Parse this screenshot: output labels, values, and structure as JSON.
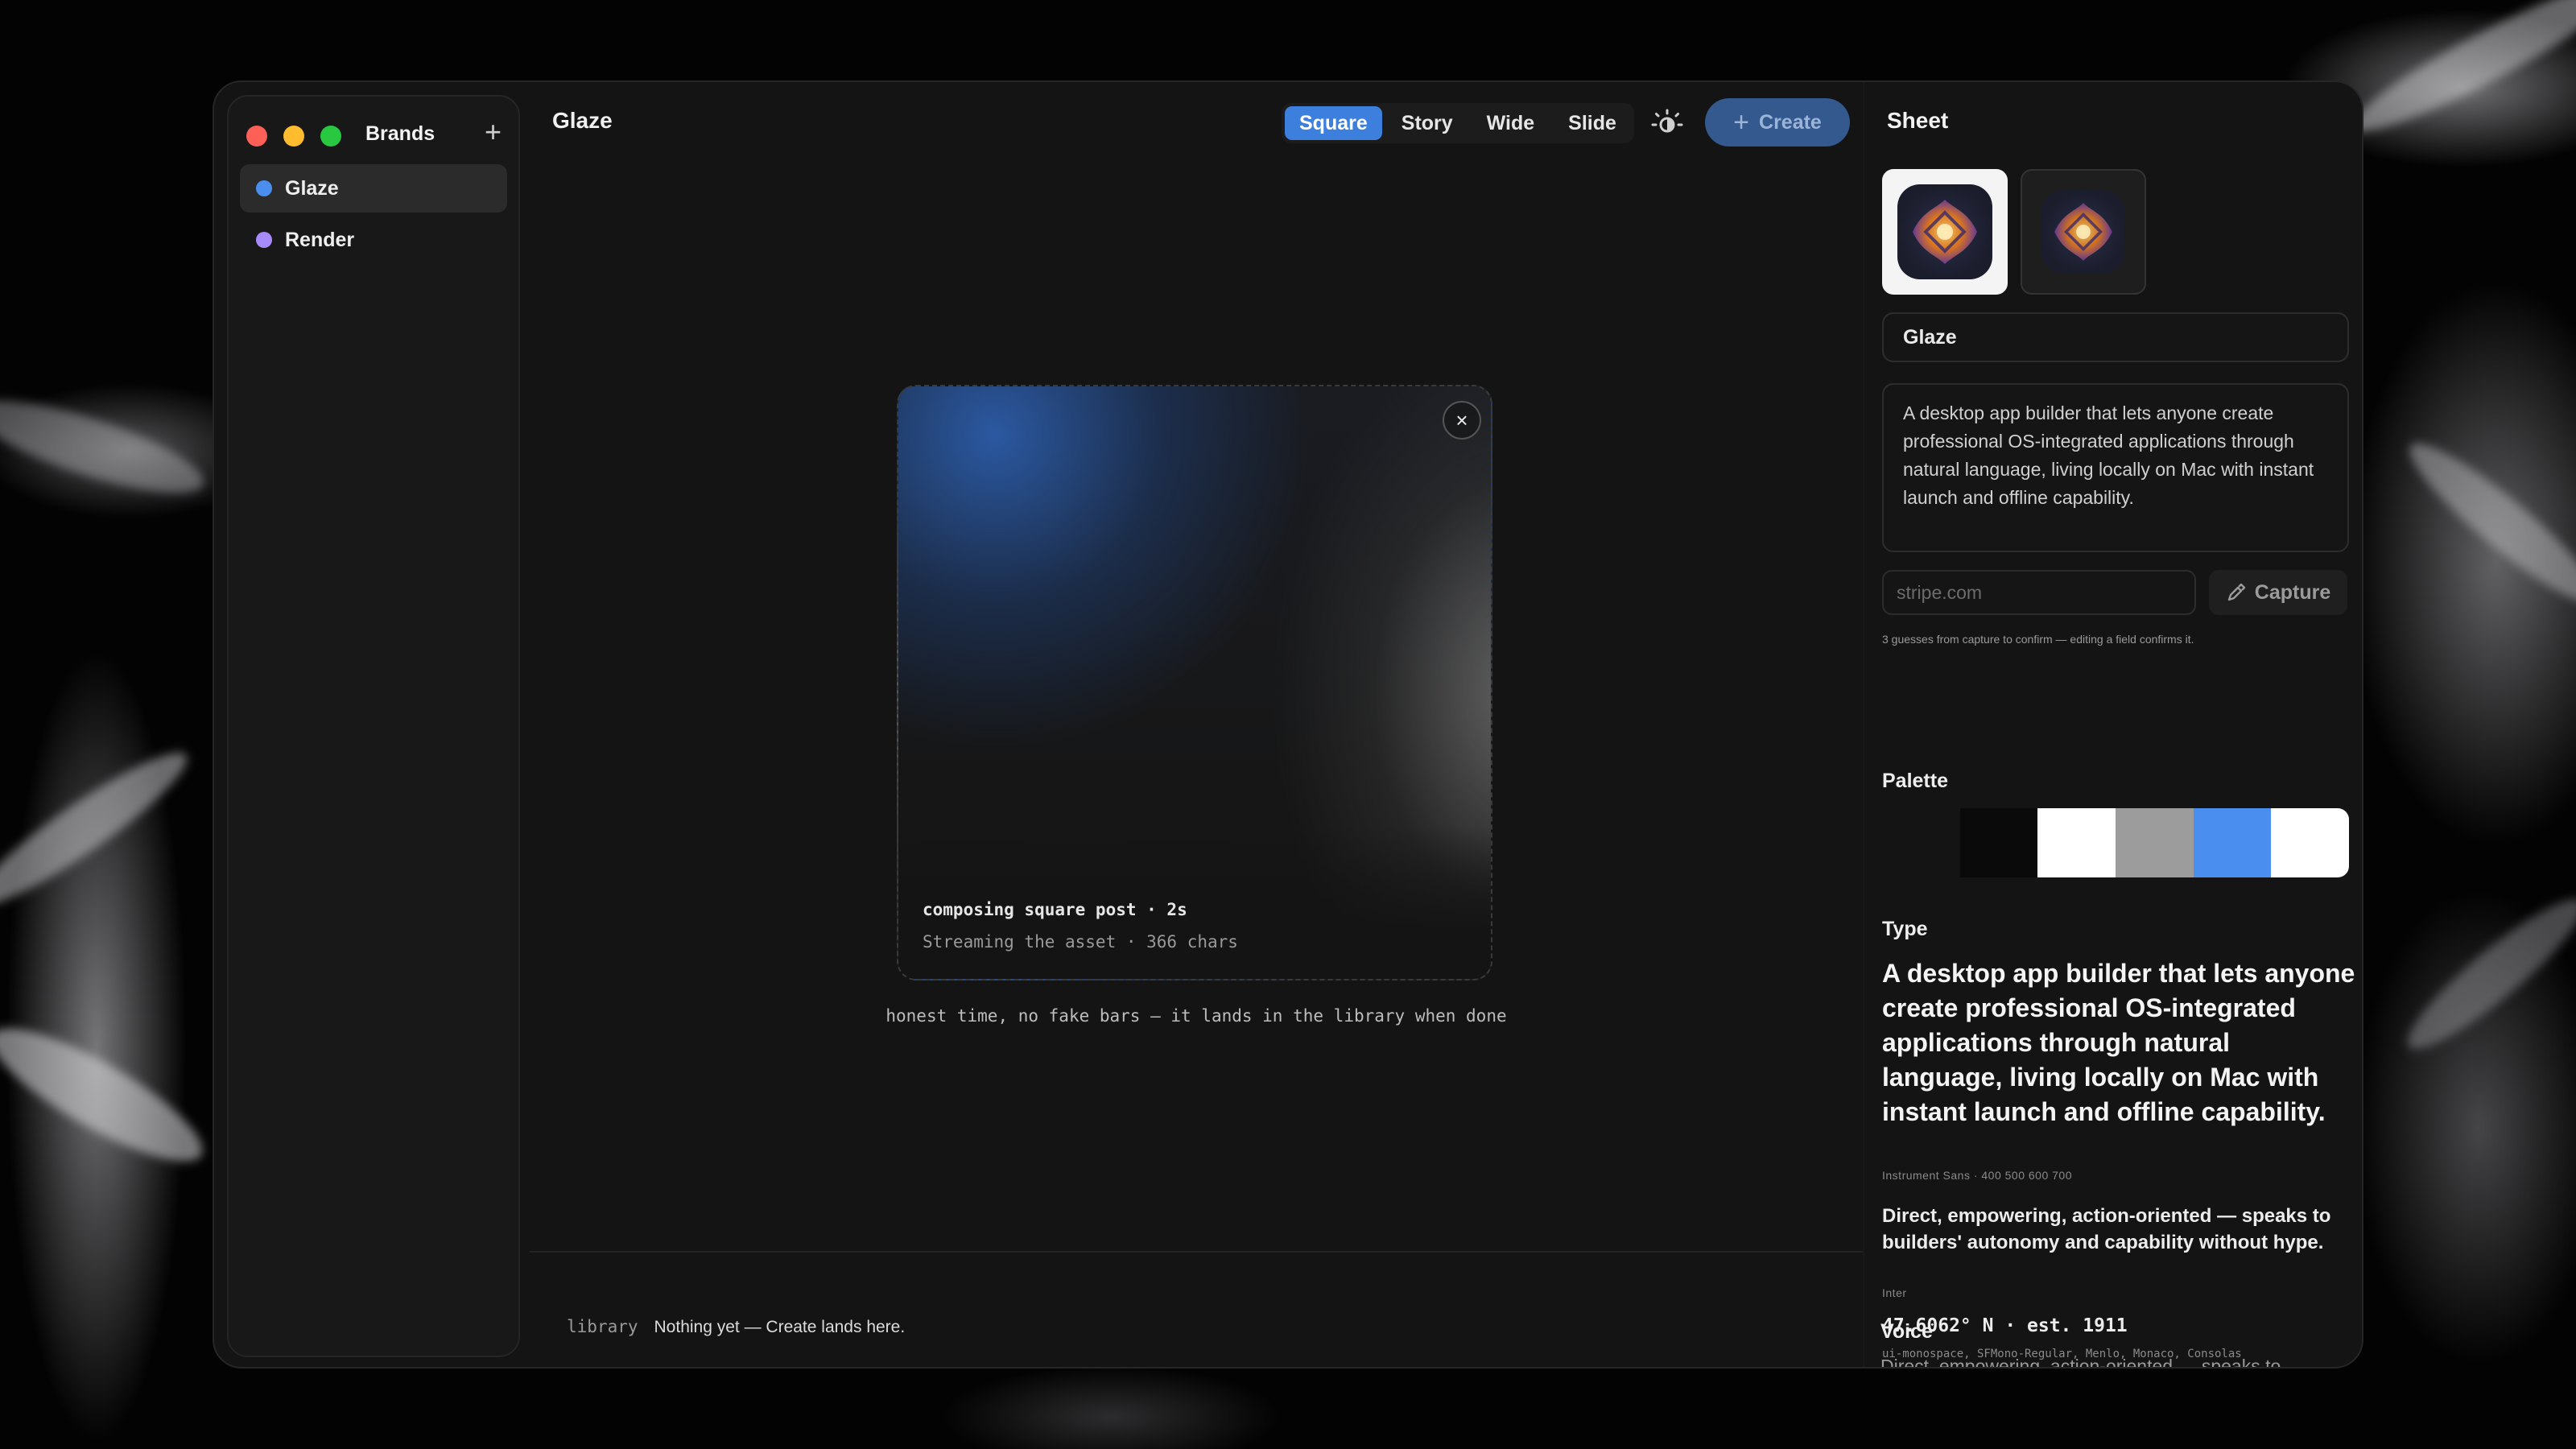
{
  "sidebar": {
    "title": "Brands",
    "add_label": "+",
    "brands": [
      {
        "label": "Glaze",
        "color": "#4a8ef0",
        "active": true
      },
      {
        "label": "Render",
        "color": "#a78bfa",
        "active": false
      }
    ]
  },
  "main": {
    "title": "Glaze",
    "formats": [
      {
        "label": "Square",
        "active": true
      },
      {
        "label": "Story",
        "active": false
      },
      {
        "label": "Wide",
        "active": false
      },
      {
        "label": "Slide",
        "active": false
      }
    ],
    "theme_icon": "sun-moon-icon",
    "create_label": "Create",
    "card": {
      "close_label": "×",
      "status_line": "composing square post · 2s",
      "progress_line": "Streaming the asset · 366 chars"
    },
    "note": "honest time, no fake bars — it lands in the library when done",
    "library": {
      "label": "library",
      "text": "Nothing yet — Create lands here."
    }
  },
  "sheet": {
    "title": "Sheet",
    "name": "Glaze",
    "description": "A desktop app builder that lets anyone create professional OS-integrated applications through natural language, living locally on Mac with instant launch and offline capability.",
    "url_placeholder": "stripe.com",
    "capture_label": "Capture",
    "hint": "3 guesses from capture to confirm — editing a field confirms it.",
    "palette_label": "Palette",
    "palette": [
      "#141414",
      "#0a0a0a",
      "#ffffff",
      "#9c9c9c",
      "#4a8ef0",
      "#ffffff"
    ],
    "type_label": "Type",
    "type_sample": "A desktop app builder that lets anyone create professional OS-integrated applications through natural language, living locally on Mac with instant launch and offline capability.",
    "type_font": "Instrument Sans · 400 500 600 700",
    "body_sample": "Direct, empowering, action-oriented — speaks to builders' autonomy and capability without hype.",
    "body_font": "Inter",
    "mono_sample": "47.6062° N · est. 1911",
    "mono_font": "ui-monospace, SFMono-Regular, Menlo, Monaco, Consolas",
    "voice_label": "Voice",
    "voice_peek": "Direct, empowering, action-oriented — speaks to"
  }
}
